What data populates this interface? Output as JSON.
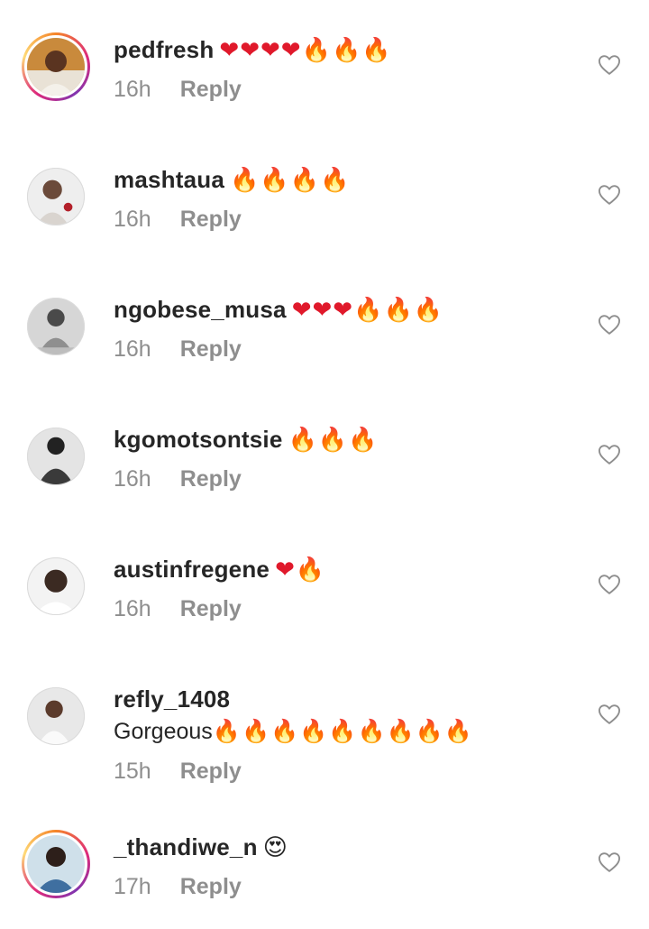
{
  "colors": {
    "text": "#262626",
    "meta": "#8e8e8e",
    "heart_emoji": "#e0192b",
    "fire_emoji": "#ff7a00",
    "story_ring": "#dd2a7b"
  },
  "icons": {
    "like": "heart-outline-icon",
    "heart_emoji": "red-heart-emoji",
    "fire_emoji": "fire-emoji",
    "heart_eyes_emoji": "heart-eyes-emoji"
  },
  "comments": [
    {
      "username": "pedfresh",
      "text": "",
      "emoji": "❤❤❤❤🔥🔥🔥",
      "time": "16h",
      "reply": "Reply",
      "story_ring": true
    },
    {
      "username": "mashtaua",
      "text": "",
      "emoji": "🔥🔥🔥🔥",
      "time": "16h",
      "reply": "Reply",
      "story_ring": false
    },
    {
      "username": "ngobese_musa",
      "text": "",
      "emoji": "❤❤❤🔥🔥🔥",
      "time": "16h",
      "reply": "Reply",
      "story_ring": false
    },
    {
      "username": "kgomotsontsie",
      "text": "",
      "emoji": "🔥🔥🔥",
      "time": "16h",
      "reply": "Reply",
      "story_ring": false
    },
    {
      "username": "austinfregene",
      "text": "",
      "emoji": "❤🔥",
      "time": "16h",
      "reply": "Reply",
      "story_ring": false
    },
    {
      "username": "refly_1408",
      "text": "Gorgeous",
      "emoji": "🔥🔥🔥🔥🔥🔥🔥🔥🔥",
      "time": "15h",
      "reply": "Reply",
      "story_ring": false
    },
    {
      "username": "_thandiwe_n",
      "text": "",
      "emoji": "😍",
      "time": "17h",
      "reply": "Reply",
      "story_ring": true
    }
  ]
}
